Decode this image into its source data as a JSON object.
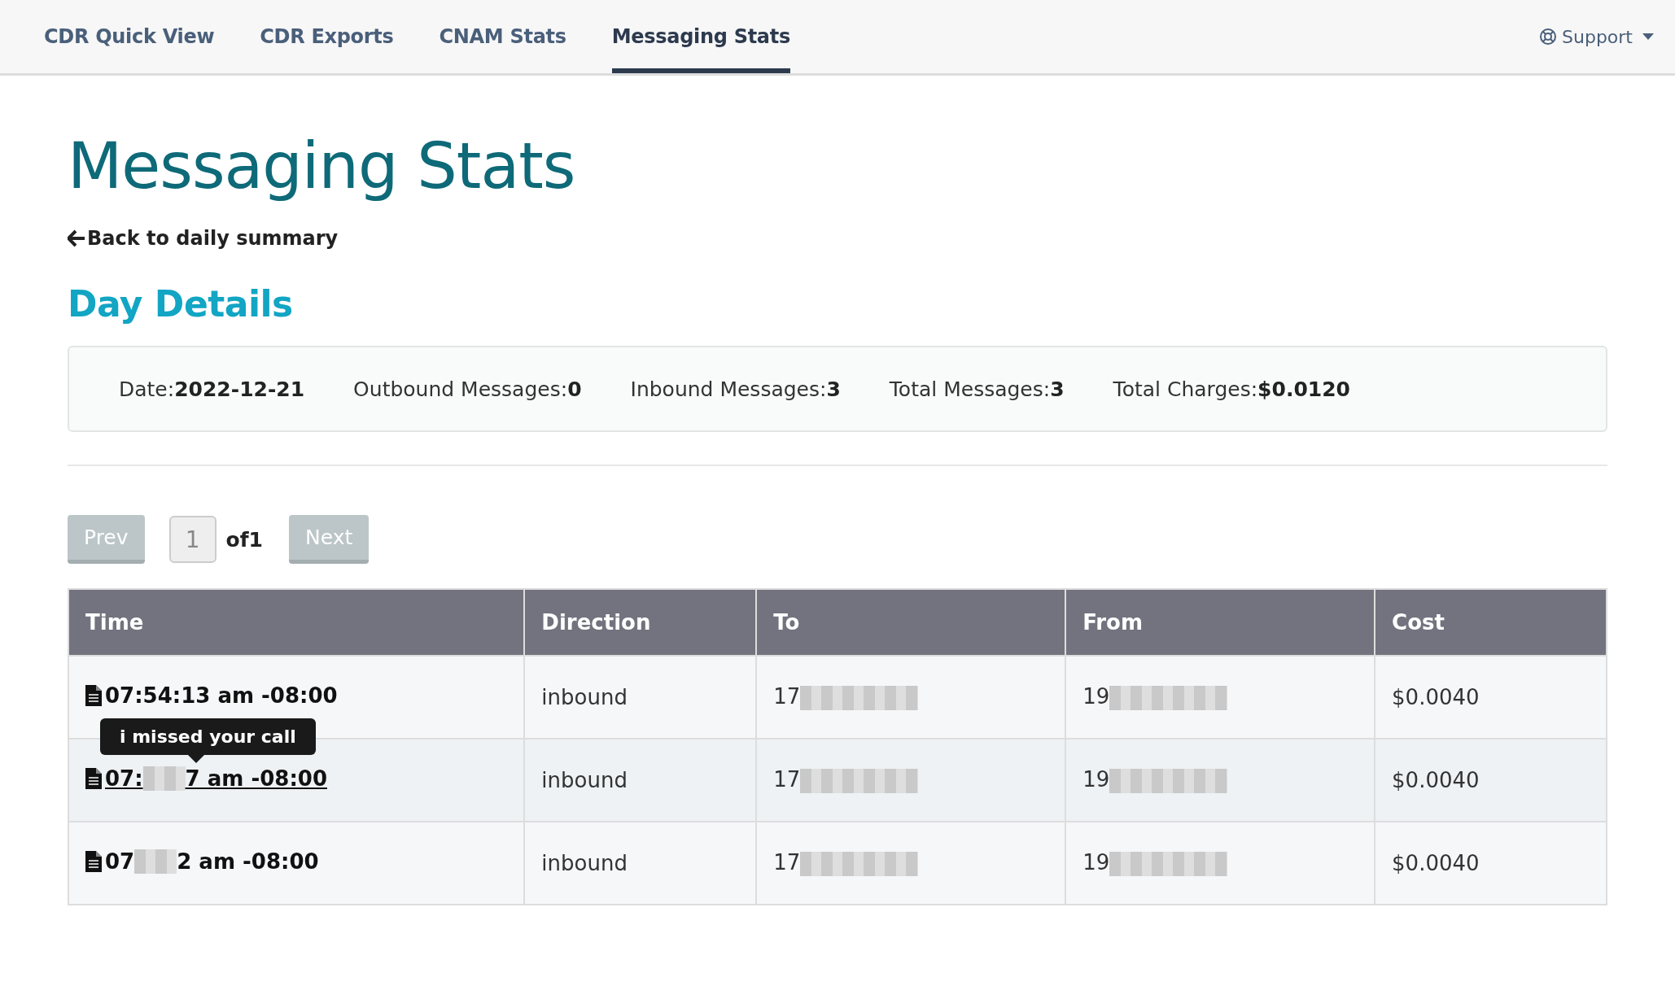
{
  "nav": {
    "tabs": [
      {
        "label": "CDR Quick View",
        "selected": false
      },
      {
        "label": "CDR Exports",
        "selected": false
      },
      {
        "label": "CNAM Stats",
        "selected": false
      },
      {
        "label": "Messaging Stats",
        "selected": true
      }
    ],
    "support": "Support"
  },
  "title": "Messaging Stats",
  "back_link": "Back to daily summary",
  "section_title": "Day Details",
  "summary": [
    {
      "label": "Date:",
      "value": "2022-12-21"
    },
    {
      "label": "Outbound Messages:",
      "value": "0"
    },
    {
      "label": "Inbound Messages:",
      "value": "3"
    },
    {
      "label": "Total Messages:",
      "value": "3"
    },
    {
      "label": "Total Charges:",
      "value": "$0.0120"
    }
  ],
  "pagination": {
    "prev": {
      "label": "Prev",
      "disabled": true
    },
    "page": "1",
    "of": "of1",
    "next": {
      "label": "Next",
      "disabled": true
    }
  },
  "table": {
    "columns": [
      "Time",
      "Direction",
      "To",
      "From",
      "Cost"
    ],
    "rows": [
      {
        "time_start": "07:54:13 am -08:00",
        "time_end": "",
        "time_redacted": false,
        "hovered": false,
        "direction": "inbound",
        "to": "17",
        "from": "19",
        "cost": "$0.0040"
      },
      {
        "time_start": "07:",
        "time_end": "7 am -08:00",
        "time_redacted": true,
        "hovered": true,
        "tooltip": "i missed your call",
        "direction": "inbound",
        "to": "17",
        "from": "19",
        "cost": "$0.0040"
      },
      {
        "time_start": "07",
        "time_end": "2 am -08:00",
        "time_redacted": true,
        "hovered": false,
        "direction": "inbound",
        "to": "17",
        "from": "19",
        "cost": "$0.0040"
      }
    ]
  }
}
